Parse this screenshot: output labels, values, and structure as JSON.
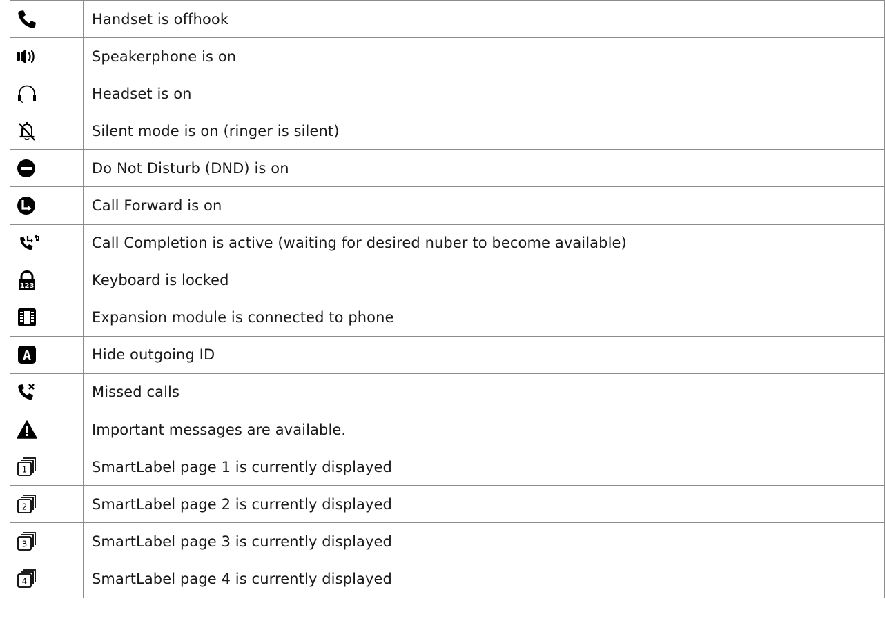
{
  "rows": [
    {
      "icon": "handset-icon",
      "text": "Handset is offhook"
    },
    {
      "icon": "speaker-icon",
      "text": "Speakerphone is on"
    },
    {
      "icon": "headset-icon",
      "text": "Headset is on"
    },
    {
      "icon": "silent-bell-icon",
      "text": "Silent mode is on (ringer is silent)"
    },
    {
      "icon": "do-not-disturb-icon",
      "text": "Do Not Disturb (DND) is on"
    },
    {
      "icon": "call-forward-icon",
      "text": "Call Forward is on"
    },
    {
      "icon": "call-completion-icon",
      "text": "Call Completion is active (waiting for desired nuber to become available)"
    },
    {
      "icon": "keyboard-lock-icon",
      "text": "Keyboard is locked"
    },
    {
      "icon": "expansion-module-icon",
      "text": "Expansion module is connected to phone"
    },
    {
      "icon": "hide-id-icon",
      "text": "Hide outgoing ID"
    },
    {
      "icon": "missed-calls-icon",
      "text": "Missed calls"
    },
    {
      "icon": "warning-icon",
      "text": "Important messages are available."
    },
    {
      "icon": "smartlabel-page-1-icon",
      "text": "SmartLabel page 1 is currently displayed",
      "page": "1"
    },
    {
      "icon": "smartlabel-page-2-icon",
      "text": "SmartLabel page 2 is currently displayed",
      "page": "2"
    },
    {
      "icon": "smartlabel-page-3-icon",
      "text": "SmartLabel page 3 is currently displayed",
      "page": "3"
    },
    {
      "icon": "smartlabel-page-4-icon",
      "text": "SmartLabel page 4 is currently displayed",
      "page": "4"
    }
  ],
  "keyboard_lock_digits": "123",
  "hide_id_letter": "A"
}
